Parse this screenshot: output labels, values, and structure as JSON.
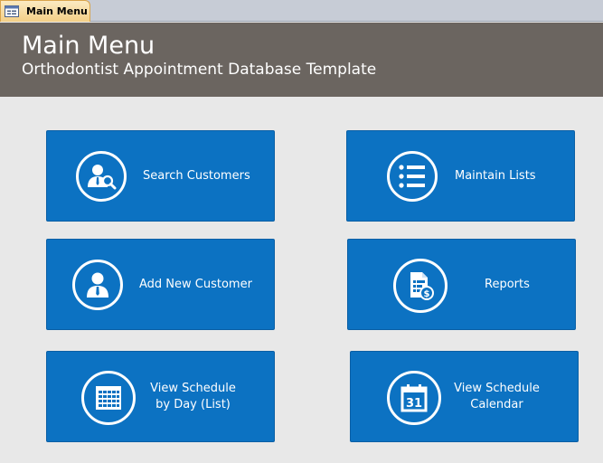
{
  "tab": {
    "label": "Main Menu"
  },
  "header": {
    "title": "Main Menu",
    "subtitle": "Orthodontist Appointment Database Template"
  },
  "buttons": {
    "search_customers": "Search Customers",
    "maintain_lists": "Maintain Lists",
    "add_new_customer": "Add New Customer",
    "reports": "Reports",
    "view_schedule_day_line1": "View Schedule",
    "view_schedule_day_line2": "by Day (List)",
    "view_schedule_calendar_line1": "View Schedule",
    "view_schedule_calendar_line2": "Calendar"
  },
  "icons": {
    "search_customers": "user-search-icon",
    "maintain_lists": "list-icon",
    "add_new_customer": "user-icon",
    "reports": "report-dollar-icon",
    "view_schedule_day": "calendar-grid-icon",
    "view_schedule_calendar": "calendar-31-icon"
  },
  "colors": {
    "tile": "#0c72c2",
    "header": "#6b6560",
    "background": "#e8e8e8",
    "tab": "#f4cf86"
  }
}
